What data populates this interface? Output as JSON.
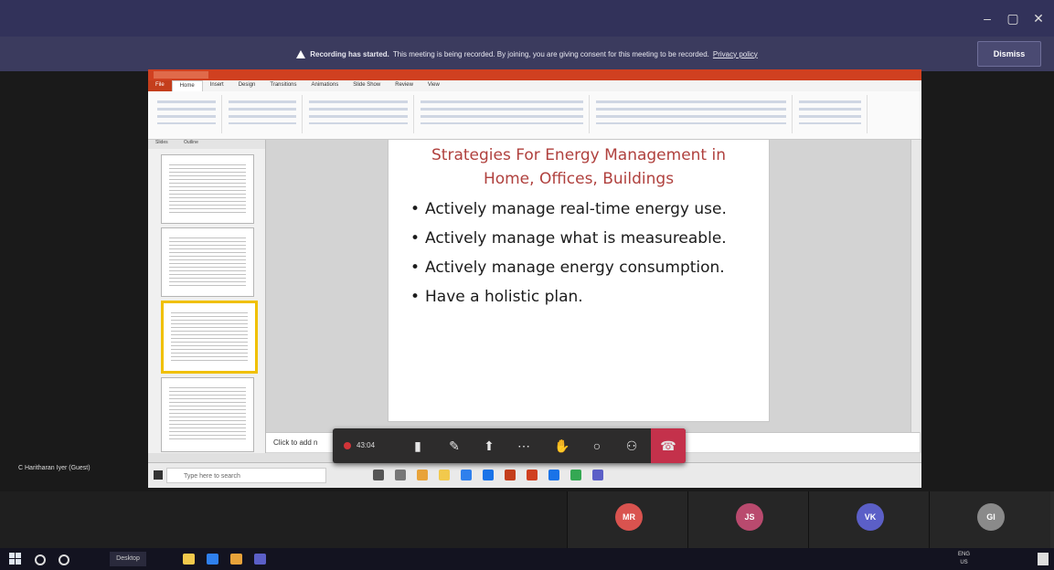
{
  "banner": {
    "title": "Recording has started.",
    "message": "This meeting is being recorded. By joining, you are giving consent for this meeting to be recorded.",
    "policy_link": "Privacy policy",
    "dismiss_label": "Dismiss"
  },
  "slide": {
    "title_line1": "Strategies For Energy Management in",
    "title_line2": "Home, Offices, Buildings",
    "bullets": [
      "Actively manage real-time energy use.",
      "Actively manage what is measureable.",
      "Actively manage energy consumption.",
      "Have a holistic plan."
    ]
  },
  "powerpoint": {
    "tabs": [
      "File",
      "Home",
      "Insert",
      "Design",
      "Transitions",
      "Animations",
      "Slide Show",
      "Review",
      "View"
    ],
    "pane_tabs": [
      "Slides",
      "Outline"
    ],
    "notes_placeholder": "Click to add n"
  },
  "meeting": {
    "timer": "43:04",
    "guest_name": "C Haritharan Iyer (Guest)",
    "participants": [
      {
        "initials": "MR",
        "color": "#d9534f"
      },
      {
        "initials": "JS",
        "color": "#b94a6e"
      },
      {
        "initials": "VK",
        "color": "#5b5fc7"
      },
      {
        "initials": "GI",
        "color": "#8a8a8a"
      }
    ]
  },
  "inner_taskbar": {
    "search_placeholder": "Type here to search"
  },
  "taskbar": {
    "desktop_label": "Desktop",
    "lang": "ENG",
    "region": "US"
  }
}
